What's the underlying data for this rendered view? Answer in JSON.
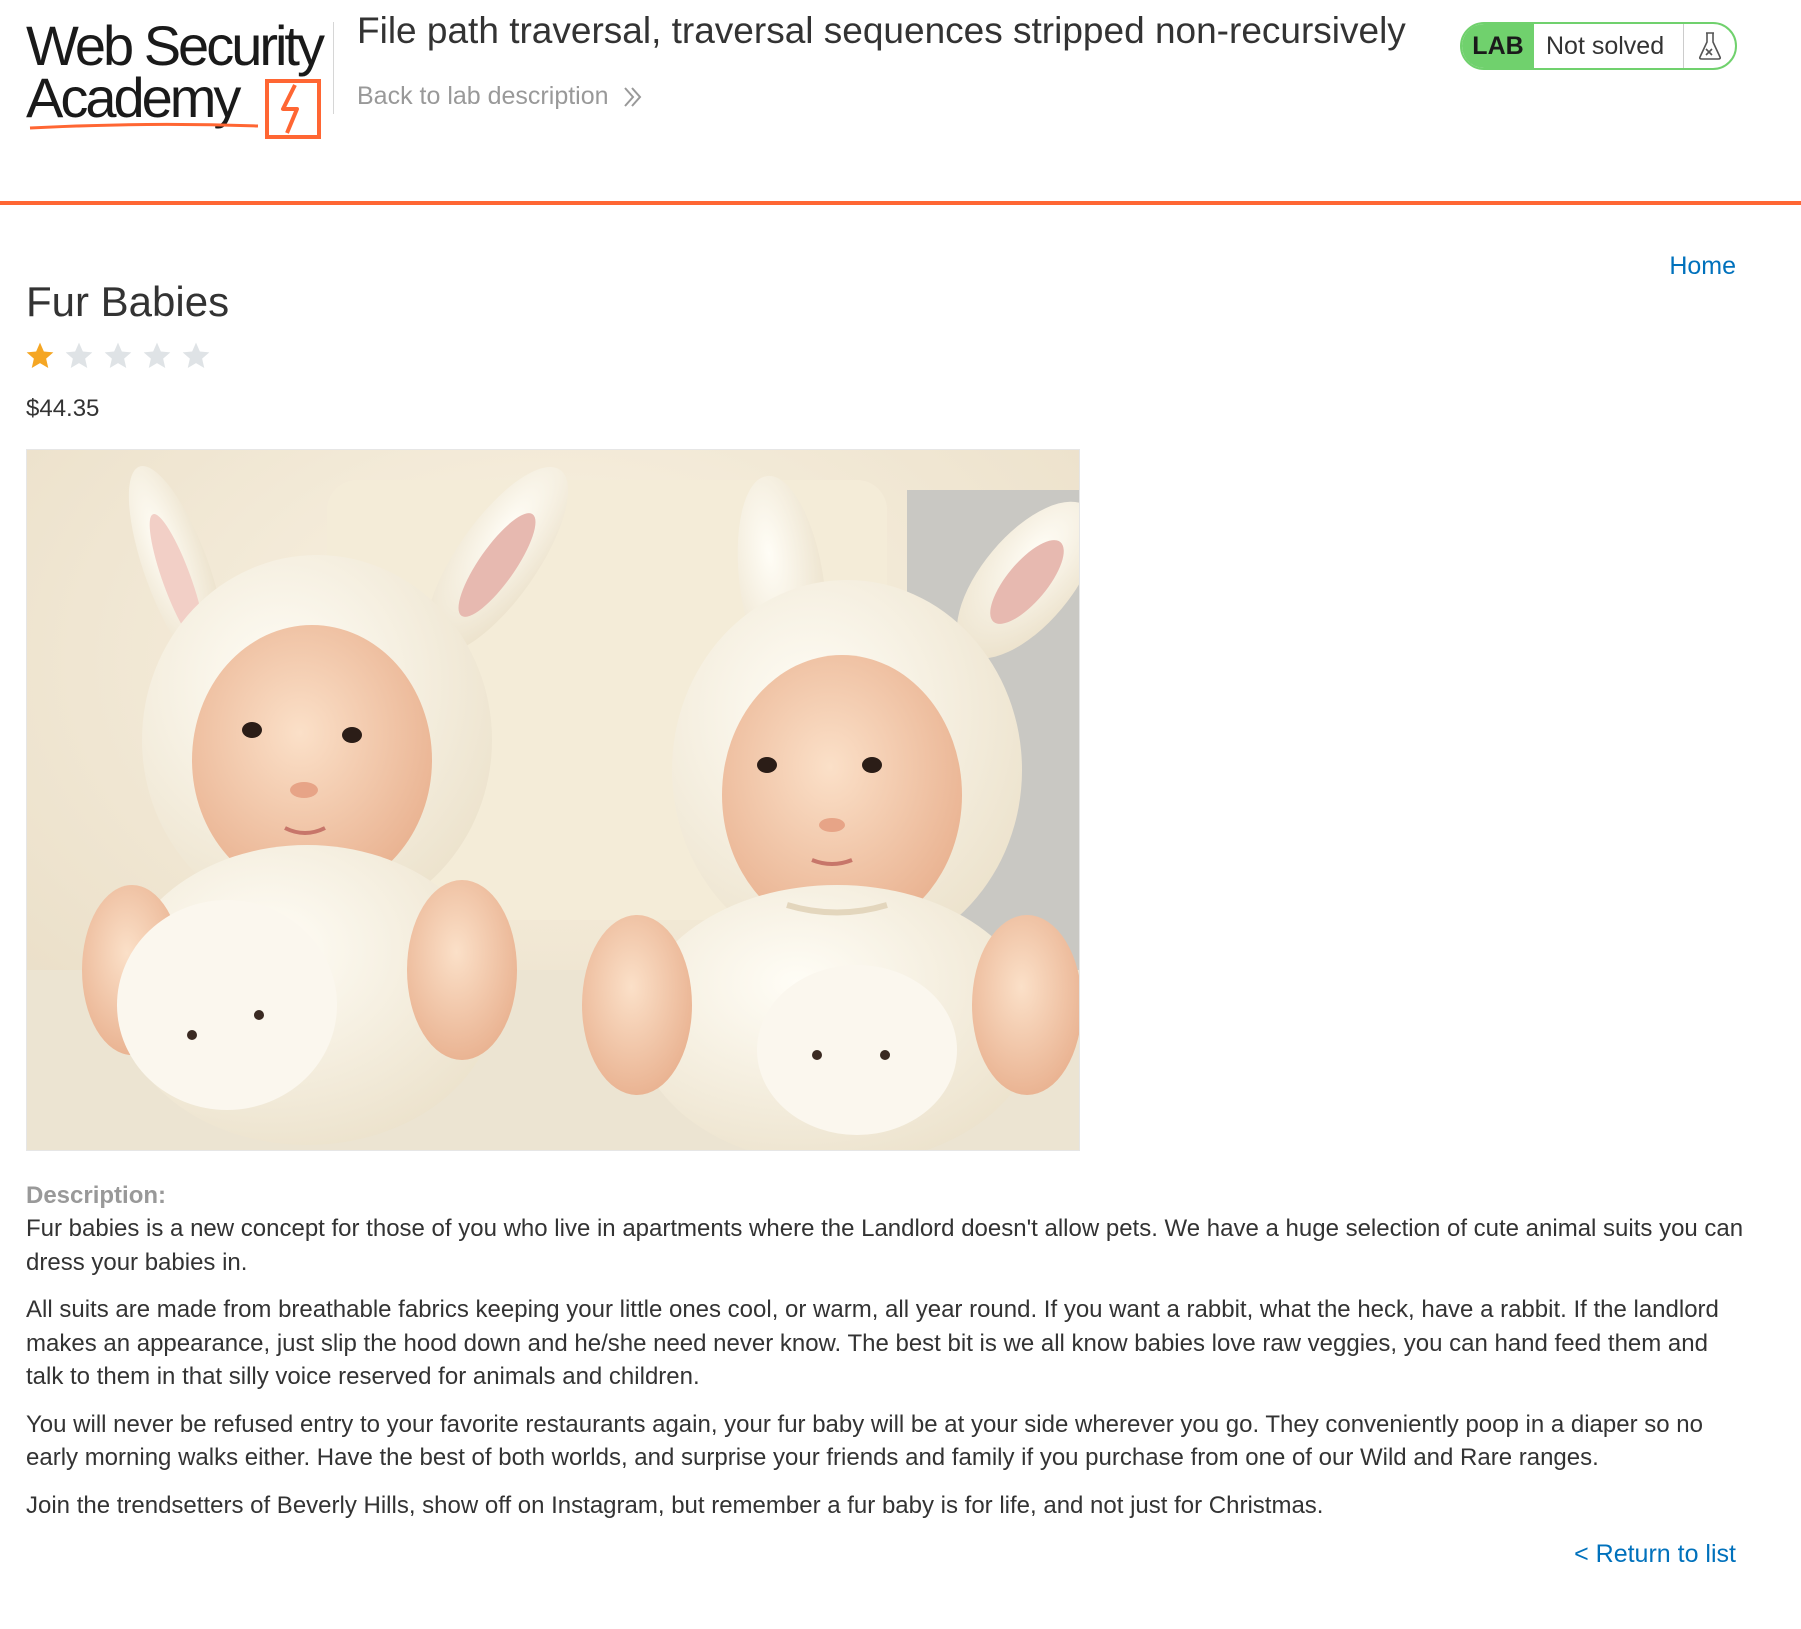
{
  "header": {
    "logo": {
      "line1": "Web Security",
      "line2": "Academy"
    },
    "lab_title": "File path traversal, traversal sequences stripped non-recursively",
    "back_link": "Back to lab description",
    "lab_badge": "LAB",
    "lab_status": "Not solved",
    "lab_icon": "flask-icon",
    "accent_color": "#ff6633",
    "status_color": "#70d16d"
  },
  "nav": {
    "home": "Home"
  },
  "product": {
    "title": "Fur Babies",
    "rating": 1,
    "rating_max": 5,
    "price": "$44.35",
    "image_alt": "two-babies-in-bunny-suits",
    "description_label": "Description:",
    "paragraphs": [
      "Fur babies is a new concept for those of you who live in apartments where the Landlord doesn't allow pets. We have a huge selection of cute animal suits you can dress your babies in.",
      "All suits are made from breathable fabrics keeping your little ones cool, or warm, all year round. If you want a rabbit, what the heck, have a rabbit. If the landlord makes an appearance, just slip the hood down and he/she need never know. The best bit is we all know babies love raw veggies, you can hand feed them and talk to them in that silly voice reserved for animals and children.",
      "You will never be refused entry to your favorite restaurants again, your fur baby will be at your side wherever you go. They conveniently poop in a diaper so no early morning walks either. Have the best of both worlds, and surprise your friends and family if you purchase from one of our Wild and Rare ranges.",
      "Join the trendsetters of Beverly Hills, show off on Instagram, but remember a fur baby is for life, and not just for Christmas."
    ],
    "return_link": "< Return to list"
  },
  "colors": {
    "link": "#0071bc",
    "star_filled": "#f5a623",
    "star_empty": "#dfe3e6"
  }
}
